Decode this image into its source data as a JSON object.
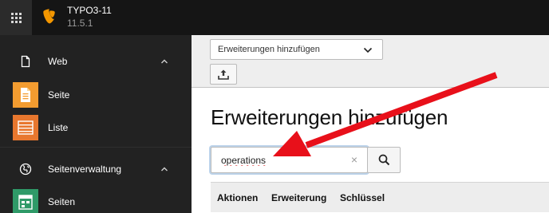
{
  "topbar": {
    "site_name": "TYPO3-11",
    "version": "11.5.1"
  },
  "sidebar": {
    "groups": [
      {
        "label": "Web",
        "icon": "document-icon"
      },
      {
        "label": "Seitenverwaltung",
        "icon": "globe-icon"
      }
    ],
    "items": [
      {
        "label": "Seite",
        "icon": "page-module-icon",
        "color": "#f39c30"
      },
      {
        "label": "Liste",
        "icon": "list-module-icon",
        "color": "#e8772e"
      },
      {
        "label": "Seiten",
        "icon": "pages-module-icon",
        "color": "#2f9a68"
      }
    ]
  },
  "docheader": {
    "select_value": "Erweiterungen hinzufügen",
    "upload_icon": "upload-icon"
  },
  "main": {
    "title": "Erweiterungen hinzufügen",
    "search_value": "operations",
    "clear_symbol": "×",
    "columns": [
      "Aktionen",
      "Erweiterung",
      "Schlüssel"
    ]
  },
  "colors": {
    "topbar": "#151515",
    "sidebar": "#222222",
    "docheader": "#eeeeee",
    "typo3_orange": "#f49700",
    "arrow": "#e8101a"
  }
}
